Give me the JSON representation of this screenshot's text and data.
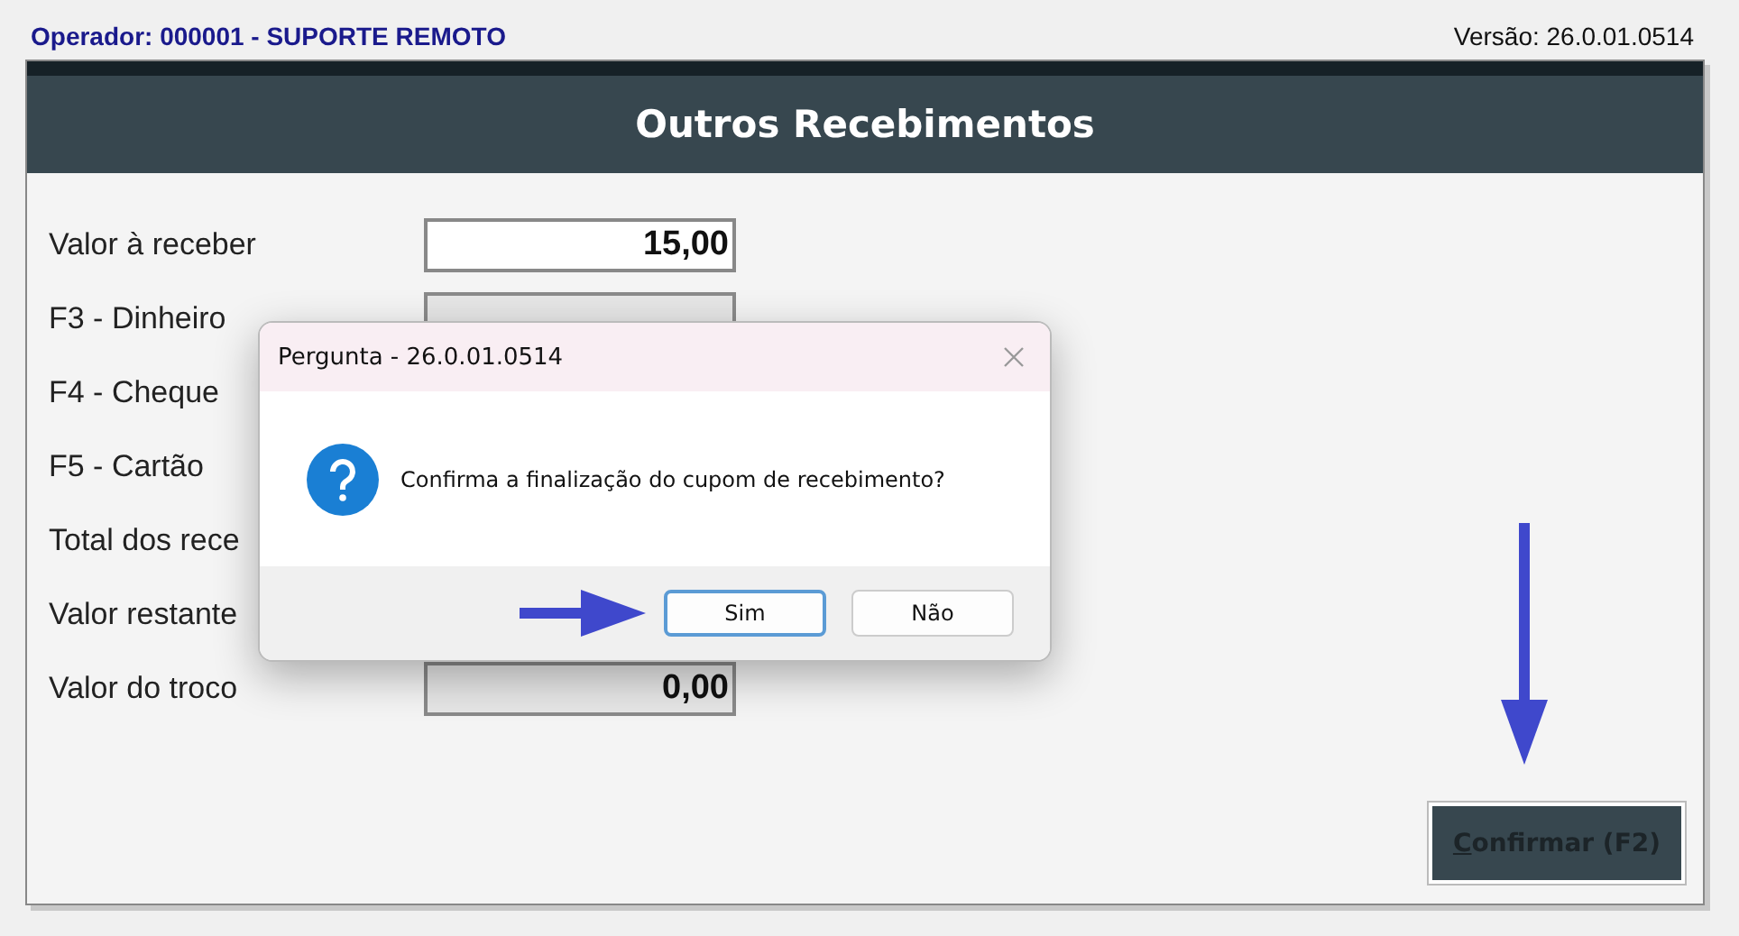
{
  "header": {
    "operator": "Operador: 000001 - SUPORTE REMOTO",
    "version": "Versão: 26.0.01.0514"
  },
  "window": {
    "title": "Outros Recebimentos"
  },
  "fields": [
    {
      "label": "Valor à receber",
      "value": "15,00",
      "editable": true
    },
    {
      "label": "F3 - Dinheiro",
      "editable": false
    },
    {
      "label": "F4 - Cheque"
    },
    {
      "label": "F5 - Cartão"
    },
    {
      "label": "Total dos rece"
    },
    {
      "label": "Valor restante"
    },
    {
      "label": "Valor do troco",
      "value": "0,00",
      "editable": false
    }
  ],
  "confirm_button": {
    "label": "Confirmar (F2)"
  },
  "dialog": {
    "title": "Pergunta - 26.0.01.0514",
    "message": "Confirma a finalização do cupom de recebimento?",
    "buttons": [
      {
        "label": "Sim",
        "selected": true
      },
      {
        "label": "Não",
        "selected": false
      }
    ]
  }
}
